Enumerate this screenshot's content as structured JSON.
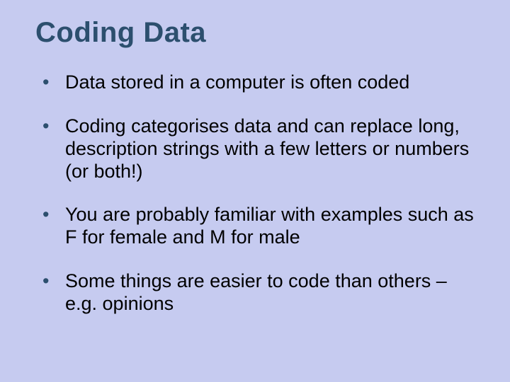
{
  "slide": {
    "title": "Coding Data",
    "bullets": [
      "Data stored in a computer is often coded",
      "Coding categorises data and can replace long, description strings with a few letters or numbers (or both!)",
      "You are probably familiar with examples such as F for female and M for male",
      "Some things are easier to code than others – e.g. opinions"
    ]
  }
}
